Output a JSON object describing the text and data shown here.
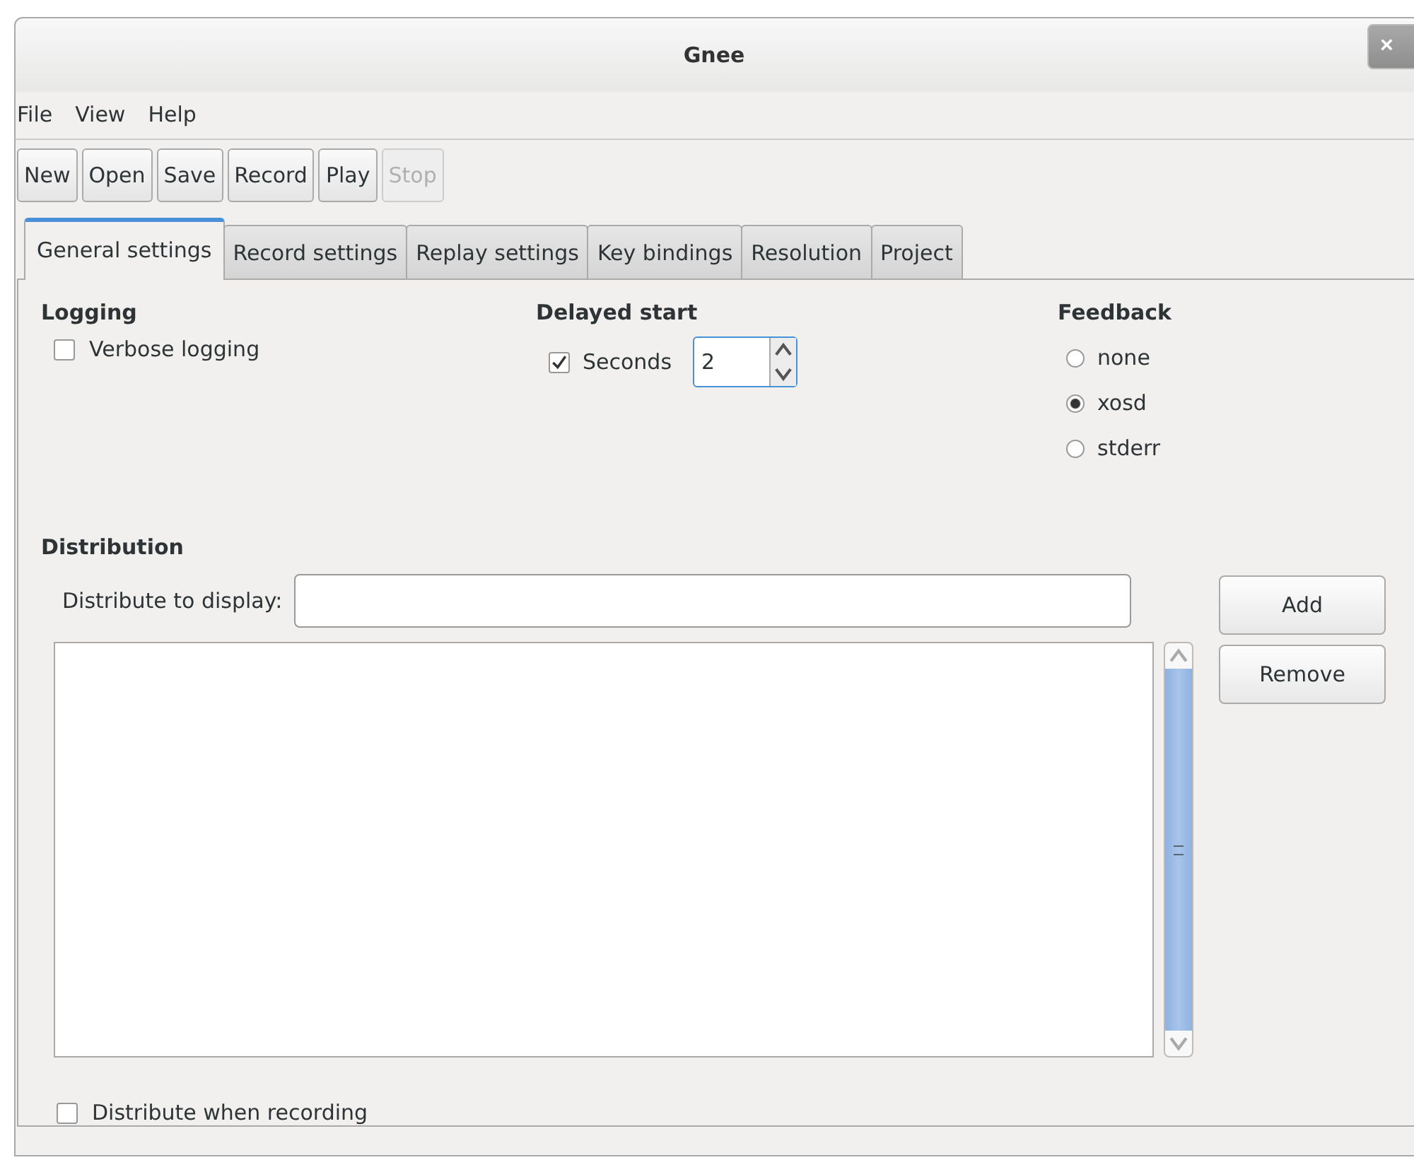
{
  "window": {
    "title": "Gnee",
    "close": "×"
  },
  "menu": [
    "File",
    "View",
    "Help"
  ],
  "toolbar": [
    {
      "label": "New",
      "disabled": false
    },
    {
      "label": "Open",
      "disabled": false
    },
    {
      "label": "Save",
      "disabled": false
    },
    {
      "label": "Record",
      "disabled": false
    },
    {
      "label": "Play",
      "disabled": false
    },
    {
      "label": "Stop",
      "disabled": true
    }
  ],
  "tabs": [
    {
      "label": "General settings",
      "selected": true
    },
    {
      "label": "Record settings",
      "selected": false
    },
    {
      "label": "Replay settings",
      "selected": false
    },
    {
      "label": "Key bindings",
      "selected": false
    },
    {
      "label": "Resolution",
      "selected": false
    },
    {
      "label": "Project",
      "selected": false
    }
  ],
  "logging": {
    "heading": "Logging",
    "verbose": {
      "label": "Verbose logging",
      "checked": false
    }
  },
  "delayed_start": {
    "heading": "Delayed start",
    "seconds": {
      "label": "Seconds",
      "checked": true
    },
    "value": "2"
  },
  "feedback": {
    "heading": "Feedback",
    "options": [
      {
        "label": "none",
        "selected": false
      },
      {
        "label": "xosd",
        "selected": true
      },
      {
        "label": "stderr",
        "selected": false
      }
    ]
  },
  "distribution": {
    "heading": "Distribution",
    "field_label": "Distribute to display:",
    "buttons": [
      "Add",
      "Remove"
    ],
    "when_recording": {
      "label": "Distribute when recording",
      "checked": false
    }
  }
}
